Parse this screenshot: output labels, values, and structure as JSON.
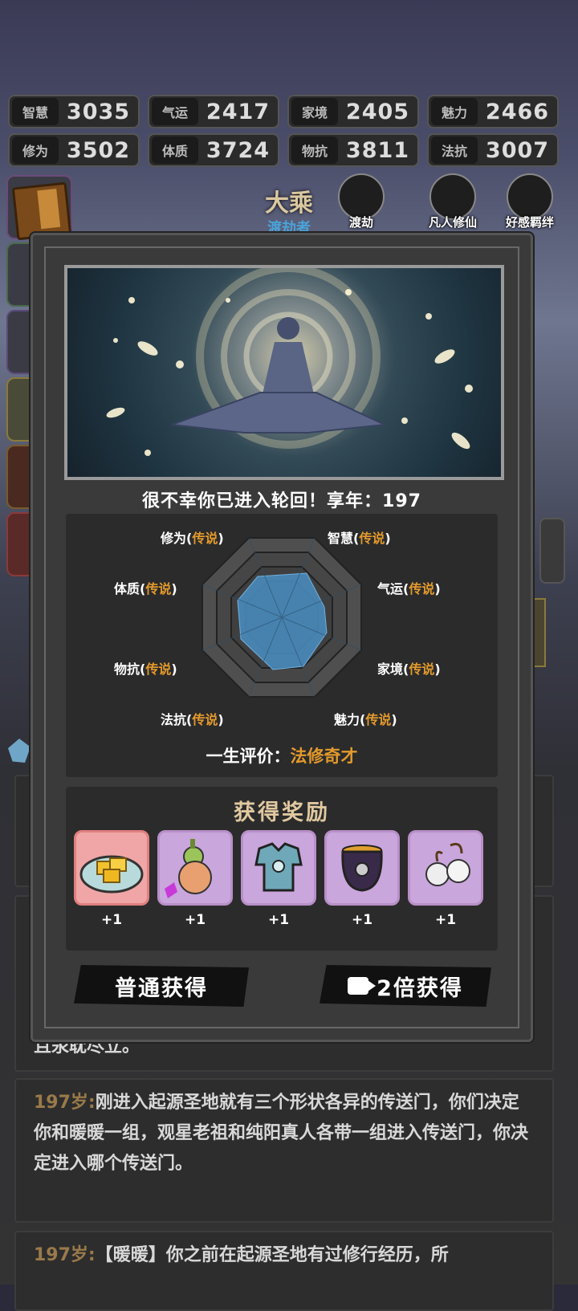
{
  "stats": [
    {
      "name": "智慧",
      "value": "3035"
    },
    {
      "name": "气运",
      "value": "2417"
    },
    {
      "name": "家境",
      "value": "2405"
    },
    {
      "name": "魅力",
      "value": "2466"
    },
    {
      "name": "修为",
      "value": "3502"
    },
    {
      "name": "体质",
      "value": "3724"
    },
    {
      "name": "物抗",
      "value": "3811"
    },
    {
      "name": "法抗",
      "value": "3007"
    }
  ],
  "realm": {
    "name": "大乘",
    "title": "渡劫者"
  },
  "top_icons": [
    {
      "label": "渡劫",
      "icon": "lock-icon"
    },
    {
      "label": "凡人修仙",
      "icon": "monk-icon"
    },
    {
      "label": "好感羁绊",
      "icon": "companion-icon"
    }
  ],
  "result": {
    "subtitle": "很不幸你已进入轮回！享年：197",
    "radar_labels": [
      {
        "name": "修为",
        "quality": "传说"
      },
      {
        "name": "智慧",
        "quality": "传说"
      },
      {
        "name": "气运",
        "quality": "传说"
      },
      {
        "name": "家境",
        "quality": "传说"
      },
      {
        "name": "魅力",
        "quality": "传说"
      },
      {
        "name": "法抗",
        "quality": "传说"
      },
      {
        "name": "物抗",
        "quality": "传说"
      },
      {
        "name": "体质",
        "quality": "传说"
      }
    ],
    "evaluation_label": "一生评价：",
    "evaluation_value": "法修奇才"
  },
  "rewards": {
    "title": "获得奖励",
    "items": [
      {
        "icon": "gold-ingot-icon",
        "count": "+1",
        "rarity": "red"
      },
      {
        "icon": "gourd-icon",
        "count": "+1",
        "rarity": "purple"
      },
      {
        "icon": "armor-icon",
        "count": "+1",
        "rarity": "purple"
      },
      {
        "icon": "cauldron-icon",
        "count": "+1",
        "rarity": "purple"
      },
      {
        "icon": "earrings-icon",
        "count": "+1",
        "rarity": "purple"
      }
    ]
  },
  "buttons": {
    "normal": "普通获得",
    "double": "2倍获得"
  },
  "log": [
    {
      "age": "",
      "text": "且汞耽尽立。"
    },
    {
      "age": "197岁:",
      "text": "刚进入起源圣地就有三个形状各异的传送门，你们决定你和暖暖一组，观星老祖和纯阳真人各带一组进入传送门，你决定进入哪个传送门。"
    },
    {
      "age": "197岁:",
      "text": "【暖暖】你之前在起源圣地有过修行经历，所"
    }
  ],
  "colors": {
    "accent": "#e39a2c",
    "radar_fill": "#4a8fc4",
    "realm_title": "#4aa3d8"
  }
}
